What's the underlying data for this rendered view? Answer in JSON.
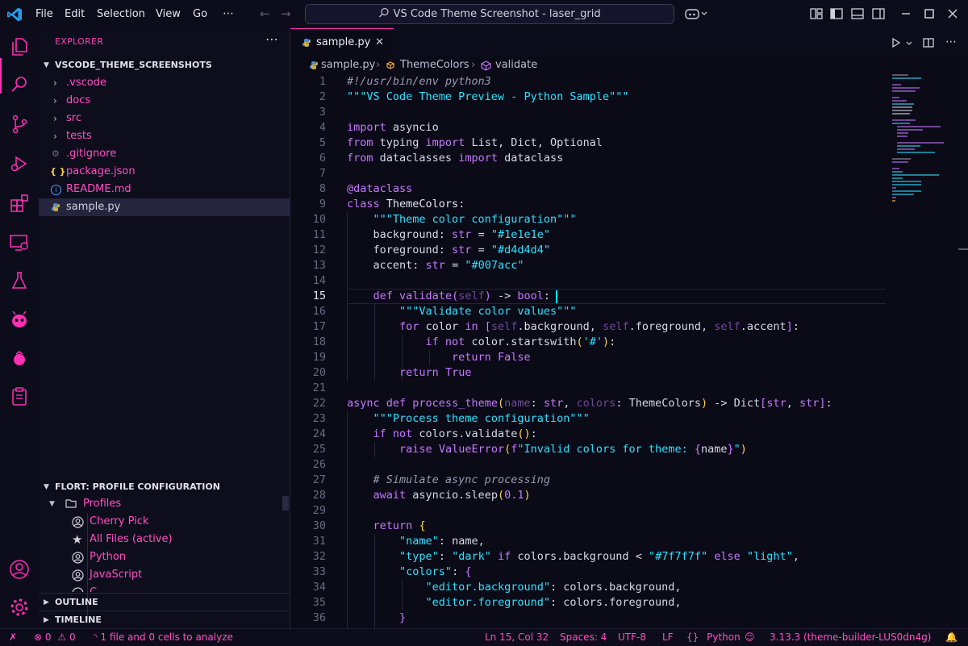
{
  "titlebar": {
    "menu": [
      "File",
      "Edit",
      "Selection",
      "View",
      "Go"
    ],
    "more": "⋯",
    "search_text": "VS Code Theme Screenshot - laser_grid"
  },
  "explorer": {
    "title": "EXPLORER",
    "more": "⋯",
    "root": "VSCODE_THEME_SCREENSHOTS",
    "folders": [
      ".vscode",
      "docs",
      "src",
      "tests"
    ],
    "files": [
      {
        "name": ".gitignore",
        "icon": "gear-icon"
      },
      {
        "name": "package.json",
        "icon": "braces-icon"
      },
      {
        "name": "README.md",
        "icon": "info-icon"
      },
      {
        "name": "sample.py",
        "icon": "python-icon"
      }
    ]
  },
  "flort": {
    "title": "FLORT: PROFILE CONFIGURATION",
    "profiles_label": "Profiles",
    "profiles": [
      {
        "name": "Cherry Pick",
        "icon": "profile-icon"
      },
      {
        "name": "All Files (active)",
        "icon": "star-icon"
      },
      {
        "name": "Python",
        "icon": "profile-icon"
      },
      {
        "name": "JavaScript",
        "icon": "profile-icon"
      },
      {
        "name": "C...",
        "icon": "profile-icon"
      }
    ]
  },
  "outline": {
    "title": "OUTLINE"
  },
  "timeline": {
    "title": "TIMELINE"
  },
  "tab": {
    "label": "sample.py",
    "close": "✕"
  },
  "breadcrumbs": [
    "sample.py",
    "ThemeColors",
    "validate"
  ],
  "editor": {
    "line_numbers": [
      "1",
      "2",
      "3",
      "4",
      "5",
      "6",
      "7",
      "8",
      "9",
      "10",
      "11",
      "12",
      "13",
      "14",
      "15",
      "16",
      "17",
      "18",
      "19",
      "20",
      "21",
      "22",
      "23",
      "24",
      "25",
      "26",
      "27",
      "28",
      "29",
      "30",
      "31",
      "32",
      "33",
      "34",
      "35",
      "36"
    ],
    "active_line": "15"
  },
  "status": {
    "errors": "0",
    "warnings": "0",
    "analysis": "1 file and 0 cells to analyze",
    "position": "Ln 15, Col 32",
    "spaces": "Spaces: 4",
    "encoding": "UTF-8",
    "eol": "LF",
    "language_braces": "{}",
    "language": "Python",
    "interpreter": "3.13.3 (theme-builder-LUS0dn4g)"
  },
  "colors": {
    "accent": "#ff2fb4",
    "background": "#0b0a17",
    "string": "#2de2ff",
    "keyword": "#c678ff"
  }
}
